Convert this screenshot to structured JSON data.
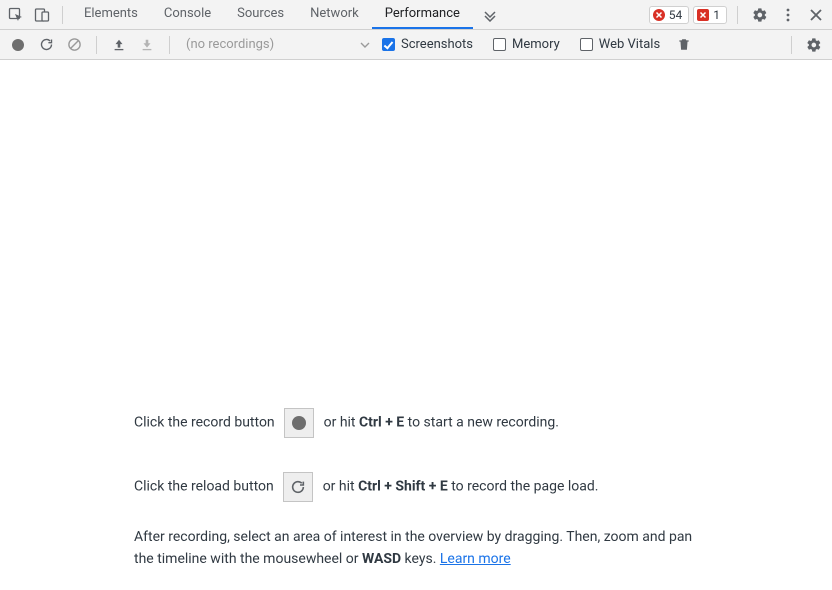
{
  "tabs": {
    "elements": "Elements",
    "console": "Console",
    "sources": "Sources",
    "network": "Network",
    "performance": "Performance"
  },
  "badges": {
    "errors_count": "54",
    "issues_count": "1"
  },
  "toolbar": {
    "recordings_placeholder": "(no recordings)",
    "screenshots_label": "Screenshots",
    "memory_label": "Memory",
    "webvitals_label": "Web Vitals"
  },
  "help": {
    "line1_pre": "Click the record button ",
    "line1_mid": " or hit ",
    "hotkey1": "Ctrl + E",
    "line1_post": " to start a new recording.",
    "line2_pre": "Click the reload button ",
    "line2_mid": " or hit ",
    "hotkey2": "Ctrl + Shift + E",
    "line2_post": " to record the page load.",
    "line3_a": "After recording, select an area of interest in the overview by dragging. Then, zoom and pan the timeline with the mousewheel or ",
    "wasd": "WASD",
    "line3_b": " keys. ",
    "learn_more": "Learn more"
  }
}
